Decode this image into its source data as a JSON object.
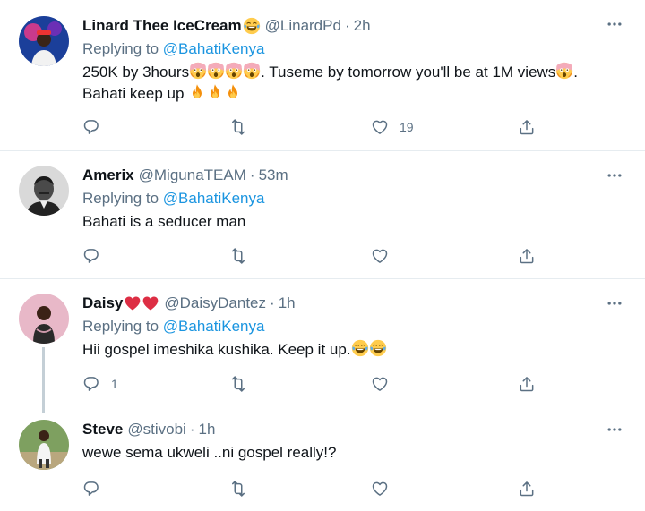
{
  "tweets": [
    {
      "name": "Linard Thee IceCream",
      "handle": "@LinardPd",
      "time": "2h",
      "replying_label": "Replying to",
      "replying_to": "@BahatiKenya",
      "text_line1_a": "250K by 3hours",
      "text_line1_b": ". Tuseme by tomorrow you'll be at 1M views",
      "text_line1_c": ".",
      "text_line2": "Bahati keep up ",
      "counts": {
        "reply": "",
        "retweet": "",
        "like": "19"
      }
    },
    {
      "name": "Amerix",
      "handle": "@MigunaTEAM",
      "time": "53m",
      "replying_label": "Replying to",
      "replying_to": "@BahatiKenya",
      "text": "Bahati is a seducer  man",
      "counts": {
        "reply": "",
        "retweet": "",
        "like": ""
      }
    },
    {
      "name": "Daisy",
      "handle": "@DaisyDantez",
      "time": "1h",
      "replying_label": "Replying to",
      "replying_to": "@BahatiKenya",
      "text": "Hii gospel imeshika kushika. Keep it up.",
      "counts": {
        "reply": "1",
        "retweet": "",
        "like": ""
      }
    },
    {
      "name": "Steve",
      "handle": "@stivobi",
      "time": "1h",
      "text": "wewe sema ukweli ..ni gospel really!?",
      "counts": {
        "reply": "",
        "retweet": "",
        "like": ""
      }
    }
  ],
  "separator": "·",
  "colors": {
    "link": "#1b95e0",
    "secondary": "#5b7083",
    "divider": "#e6ecf0",
    "thread_line": "#c4cfd6"
  },
  "icons": {
    "more": "more-horizontal-icon",
    "reply": "reply-icon",
    "retweet": "retweet-icon",
    "like": "heart-icon",
    "share": "share-icon",
    "emoji_laugh": "face-with-tears-of-joy-emoji",
    "emoji_shock": "screaming-face-emoji",
    "emoji_fire": "fire-emoji",
    "emoji_heart": "red-heart-emoji"
  }
}
